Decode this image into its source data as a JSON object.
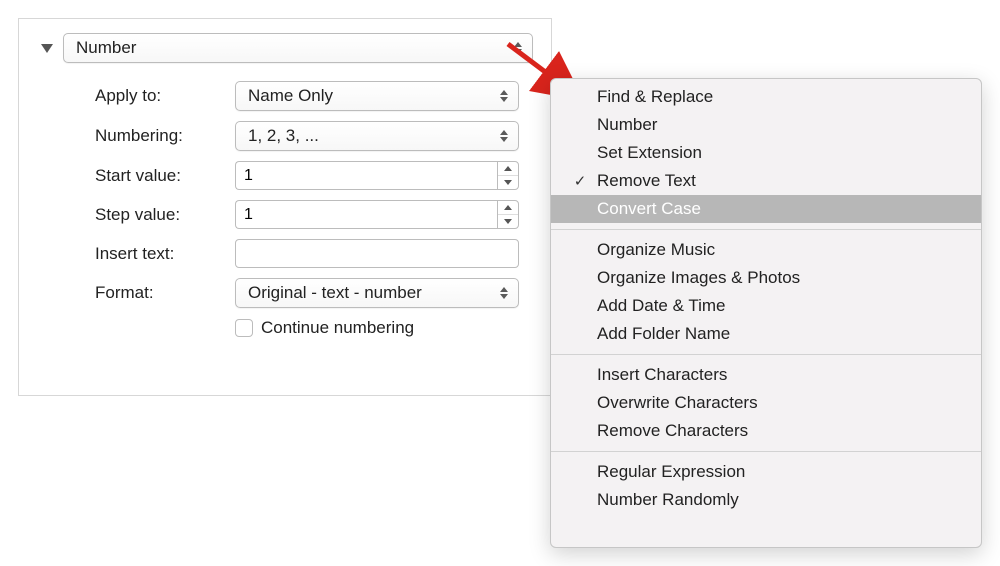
{
  "panel": {
    "main_popup": "Number",
    "rows": {
      "apply_to": {
        "label": "Apply to:",
        "value": "Name Only"
      },
      "numbering": {
        "label": "Numbering:",
        "value": "1, 2, 3, ..."
      },
      "start_value": {
        "label": "Start value:",
        "value": "1"
      },
      "step_value": {
        "label": "Step value:",
        "value": "1"
      },
      "insert_text": {
        "label": "Insert text:",
        "value": ""
      },
      "format": {
        "label": "Format:",
        "value": "Original - text - number"
      }
    },
    "continue_label": "Continue numbering"
  },
  "menu": {
    "groups": [
      [
        "Find & Replace",
        "Number",
        "Set Extension",
        "Remove Text",
        "Convert Case"
      ],
      [
        "Organize Music",
        "Organize Images & Photos",
        "Add Date & Time",
        "Add Folder Name"
      ],
      [
        "Insert Characters",
        "Overwrite Characters",
        "Remove Characters"
      ],
      [
        "Regular Expression",
        "Number Randomly"
      ]
    ],
    "checked": "Remove Text",
    "highlighted": "Convert Case"
  }
}
